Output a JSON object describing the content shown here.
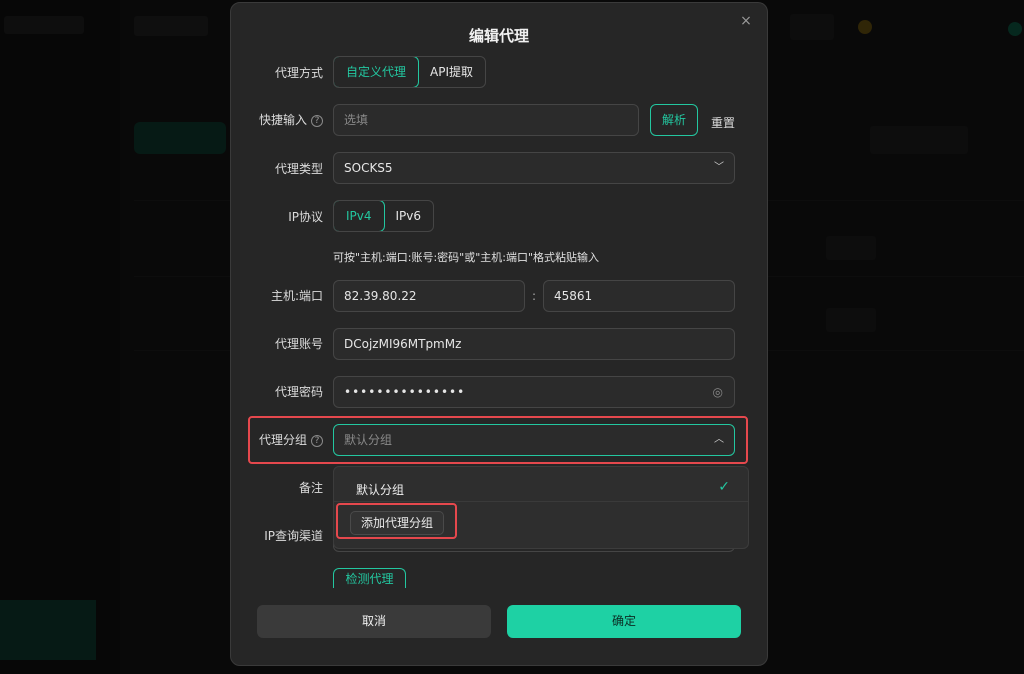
{
  "modal": {
    "title": "编辑代理",
    "close_icon": "×"
  },
  "proxy_method": {
    "label": "代理方式",
    "options": [
      "自定义代理",
      "API提取"
    ],
    "selected": "自定义代理"
  },
  "quick_input": {
    "label": "快捷输入",
    "help_icon": "?",
    "placeholder": "选填",
    "parse_label": "解析",
    "reset_label": "重置"
  },
  "proxy_type": {
    "label": "代理类型",
    "value": "SOCKS5"
  },
  "ip_protocol": {
    "label": "IP协议",
    "options": [
      "IPv4",
      "IPv6"
    ],
    "selected": "IPv4"
  },
  "hint": "可按\"主机:端口:账号:密码\"或\"主机:端口\"格式粘贴输入",
  "host_port": {
    "label": "主机:端口",
    "host": "82.39.80.22",
    "separator": ":",
    "port": "45861"
  },
  "account": {
    "label": "代理账号",
    "value": "DCojzMI96MTpmMz"
  },
  "password": {
    "label": "代理密码",
    "value": "•••••••••••••••"
  },
  "proxy_group": {
    "label": "代理分组",
    "help_icon": "?",
    "placeholder": "默认分组",
    "options": [
      "默认分组"
    ],
    "selected": "默认分组",
    "add_label": "添加代理分组"
  },
  "remark": {
    "label": "备注"
  },
  "ip_channel": {
    "label": "IP查询渠道"
  },
  "test_label": "检测代理",
  "footer": {
    "cancel_label": "取消",
    "ok_label": "确定"
  },
  "colors": {
    "accent": "#1ed1a4",
    "highlight": "#e5484d"
  }
}
